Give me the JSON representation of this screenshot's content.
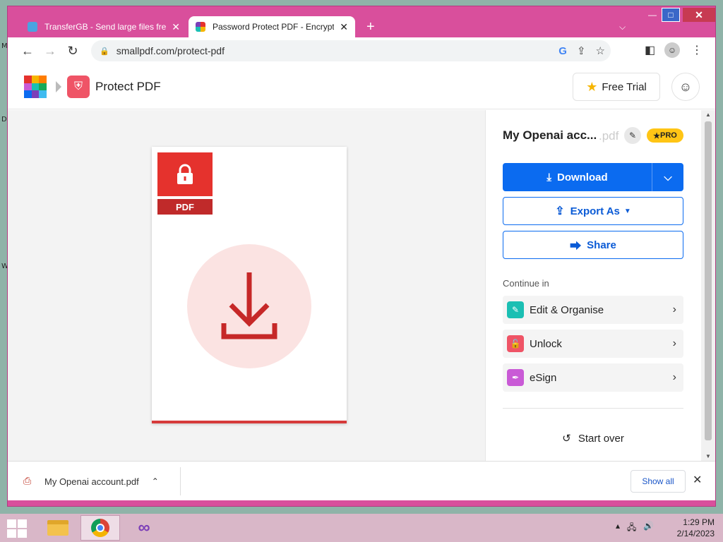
{
  "desktop": {
    "glyphs": [
      "M",
      "D",
      "W"
    ]
  },
  "tabs": [
    {
      "title": "TransferGB - Send large files free",
      "active": false
    },
    {
      "title": "Password Protect PDF - Encrypt your PDF",
      "active": true
    }
  ],
  "toolbar": {
    "url": "smallpdf.com/protect-pdf"
  },
  "header": {
    "tool_title": "Protect PDF",
    "free_trial": "Free Trial"
  },
  "preview": {
    "badge": "PDF"
  },
  "panel": {
    "file_name": "My Openai acc...",
    "file_ext": ".pdf",
    "pro": "PRO",
    "download": "Download",
    "export_as": "Export As",
    "share": "Share",
    "continue_in": "Continue in",
    "items": [
      {
        "label": "Edit & Organise",
        "color": "#1bbfb3"
      },
      {
        "label": "Unlock",
        "color": "#ef5466"
      },
      {
        "label": "eSign",
        "color": "#c95ad6"
      }
    ],
    "start_over": "Start over"
  },
  "download_shelf": {
    "file": "My Openai account.pdf",
    "show_all": "Show all"
  },
  "taskbar": {
    "time": "1:29 PM",
    "date": "2/14/2023"
  }
}
